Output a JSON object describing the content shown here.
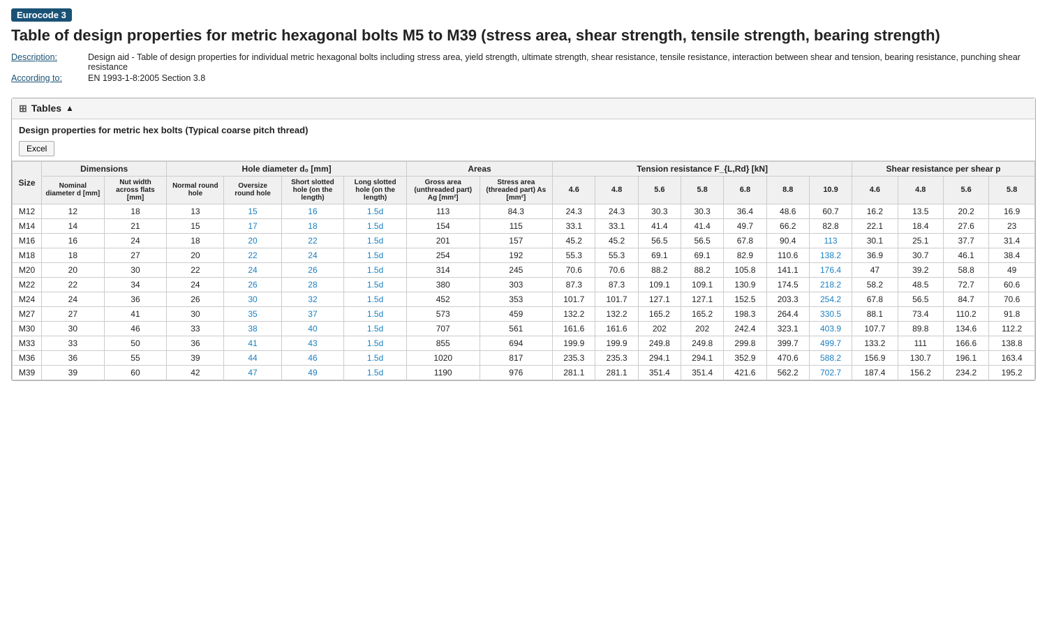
{
  "badge": "Eurocode 3",
  "title": "Table of design properties for metric hexagonal bolts M5 to M39 (stress area, shear strength, tensile strength, bearing strength)",
  "meta": {
    "description_label": "Description:",
    "description_text": "Design aid - Table of design properties for individual metric hexagonal bolts including stress area, yield strength, ultimate strength, shear resistance, tensile resistance, interaction between shear and tension, bearing resistance, punching shear resistance",
    "according_label": "According to:",
    "according_text": "EN 1993-1-8:2005 Section 3.8"
  },
  "tables_header": "Tables",
  "table_title": "Design properties for metric hex bolts (Typical coarse pitch thread)",
  "excel_button": "Excel",
  "column_groups": {
    "dimensions": "Dimensions",
    "hole_diameter": "Hole diameter d₀ [mm]",
    "areas": "Areas",
    "tension_resistance": "Tension resistance F_{L,Rd} [kN]",
    "shear_resistance": "Shear resistance per shear p"
  },
  "sub_headers": {
    "size": "Size",
    "nominal_diameter": "Nominal diameter d [mm]",
    "nut_width": "Nut width across flats [mm]",
    "normal_round_hole": "Normal round hole",
    "oversize_round_hole": "Oversize round hole",
    "short_slotted_hole": "Short slotted hole (on the length)",
    "long_slotted_hole": "Long slotted hole (on the length)",
    "gross_area": "Gross area (unthreaded part) Ag [mm²]",
    "stress_area": "Stress area (threaded part) As [mm²]",
    "t46": "4.6",
    "t48": "4.8",
    "t56": "5.6",
    "t58": "5.8",
    "t68": "6.8",
    "t88": "8.8",
    "t109": "10.9",
    "s46": "4.6",
    "s48": "4.8",
    "s56": "5.6",
    "s58": "5.8"
  },
  "rows": [
    {
      "size": "M12",
      "d": 12,
      "nut": 18,
      "normal": 13,
      "oversize": 15,
      "short": 16,
      "long": "1.5d",
      "gross": 113,
      "stress": 84.3,
      "t46": 24.3,
      "t48": 24.3,
      "t56": 30.3,
      "t58": 30.3,
      "t68": 36.4,
      "t88": 48.6,
      "t109": 60.7,
      "s46": 16.2,
      "s48": 13.5,
      "s56": 20.2,
      "s58": 16.9
    },
    {
      "size": "M14",
      "d": 14,
      "nut": 21,
      "normal": 15,
      "oversize": 17,
      "short": 18,
      "long": "1.5d",
      "gross": 154,
      "stress": 115,
      "t46": 33.1,
      "t48": 33.1,
      "t56": 41.4,
      "t58": 41.4,
      "t68": 49.7,
      "t88": 66.2,
      "t109": 82.8,
      "s46": 22.1,
      "s48": 18.4,
      "s56": 27.6,
      "s58": 23.0
    },
    {
      "size": "M16",
      "d": 16,
      "nut": 24,
      "normal": 18,
      "oversize": 20,
      "short": 22,
      "long": "1.5d",
      "gross": 201,
      "stress": 157,
      "t46": 45.2,
      "t48": 45.2,
      "t56": 56.5,
      "t58": 56.5,
      "t68": 67.8,
      "t88": 90.4,
      "t109": 113.0,
      "s46": 30.1,
      "s48": 25.1,
      "s56": 37.7,
      "s58": 31.4
    },
    {
      "size": "M18",
      "d": 18,
      "nut": 27,
      "normal": 20,
      "oversize": 22,
      "short": 24,
      "long": "1.5d",
      "gross": 254,
      "stress": 192,
      "t46": 55.3,
      "t48": 55.3,
      "t56": 69.1,
      "t58": 69.1,
      "t68": 82.9,
      "t88": 110.6,
      "t109": 138.2,
      "s46": 36.9,
      "s48": 30.7,
      "s56": 46.1,
      "s58": 38.4
    },
    {
      "size": "M20",
      "d": 20,
      "nut": 30,
      "normal": 22,
      "oversize": 24,
      "short": 26,
      "long": "1.5d",
      "gross": 314,
      "stress": 245,
      "t46": 70.6,
      "t48": 70.6,
      "t56": 88.2,
      "t58": 88.2,
      "t68": 105.8,
      "t88": 141.1,
      "t109": 176.4,
      "s46": 47.0,
      "s48": 39.2,
      "s56": 58.8,
      "s58": 49.0
    },
    {
      "size": "M22",
      "d": 22,
      "nut": 34,
      "normal": 24,
      "oversize": 26,
      "short": 28,
      "long": "1.5d",
      "gross": 380,
      "stress": 303,
      "t46": 87.3,
      "t48": 87.3,
      "t56": 109.1,
      "t58": 109.1,
      "t68": 130.9,
      "t88": 174.5,
      "t109": 218.2,
      "s46": 58.2,
      "s48": 48.5,
      "s56": 72.7,
      "s58": 60.6
    },
    {
      "size": "M24",
      "d": 24,
      "nut": 36,
      "normal": 26,
      "oversize": 30,
      "short": 32,
      "long": "1.5d",
      "gross": 452,
      "stress": 353,
      "t46": 101.7,
      "t48": 101.7,
      "t56": 127.1,
      "t58": 127.1,
      "t68": 152.5,
      "t88": 203.3,
      "t109": 254.2,
      "s46": 67.8,
      "s48": 56.5,
      "s56": 84.7,
      "s58": 70.6
    },
    {
      "size": "M27",
      "d": 27,
      "nut": 41,
      "normal": 30,
      "oversize": 35,
      "short": 37,
      "long": "1.5d",
      "gross": 573,
      "stress": 459,
      "t46": 132.2,
      "t48": 132.2,
      "t56": 165.2,
      "t58": 165.2,
      "t68": 198.3,
      "t88": 264.4,
      "t109": 330.5,
      "s46": 88.1,
      "s48": 73.4,
      "s56": 110.2,
      "s58": 91.8
    },
    {
      "size": "M30",
      "d": 30,
      "nut": 46,
      "normal": 33,
      "oversize": 38,
      "short": 40,
      "long": "1.5d",
      "gross": 707,
      "stress": 561,
      "t46": 161.6,
      "t48": 161.6,
      "t56": 202.0,
      "t58": 202.0,
      "t68": 242.4,
      "t88": 323.1,
      "t109": 403.9,
      "s46": 107.7,
      "s48": 89.8,
      "s56": 134.6,
      "s58": 112.2
    },
    {
      "size": "M33",
      "d": 33,
      "nut": 50,
      "normal": 36,
      "oversize": 41,
      "short": 43,
      "long": "1.5d",
      "gross": 855,
      "stress": 694,
      "t46": 199.9,
      "t48": 199.9,
      "t56": 249.8,
      "t58": 249.8,
      "t68": 299.8,
      "t88": 399.7,
      "t109": 499.7,
      "s46": 133.2,
      "s48": 111.0,
      "s56": 166.6,
      "s58": 138.8
    },
    {
      "size": "M36",
      "d": 36,
      "nut": 55,
      "normal": 39,
      "oversize": 44,
      "short": 46,
      "long": "1.5d",
      "gross": 1020,
      "stress": 817,
      "t46": 235.3,
      "t48": 235.3,
      "t56": 294.1,
      "t58": 294.1,
      "t68": 352.9,
      "t88": 470.6,
      "t109": 588.2,
      "s46": 156.9,
      "s48": 130.7,
      "s56": 196.1,
      "s58": 163.4
    },
    {
      "size": "M39",
      "d": 39,
      "nut": 60,
      "normal": 42,
      "oversize": 47,
      "short": 49,
      "long": "1.5d",
      "gross": 1190,
      "stress": 976,
      "t46": 281.1,
      "t48": 281.1,
      "t56": 351.4,
      "t58": 351.4,
      "t68": 421.6,
      "t88": 562.2,
      "t109": 702.7,
      "s46": 187.4,
      "s48": 156.2,
      "s56": 234.2,
      "s58": 195.2
    }
  ]
}
